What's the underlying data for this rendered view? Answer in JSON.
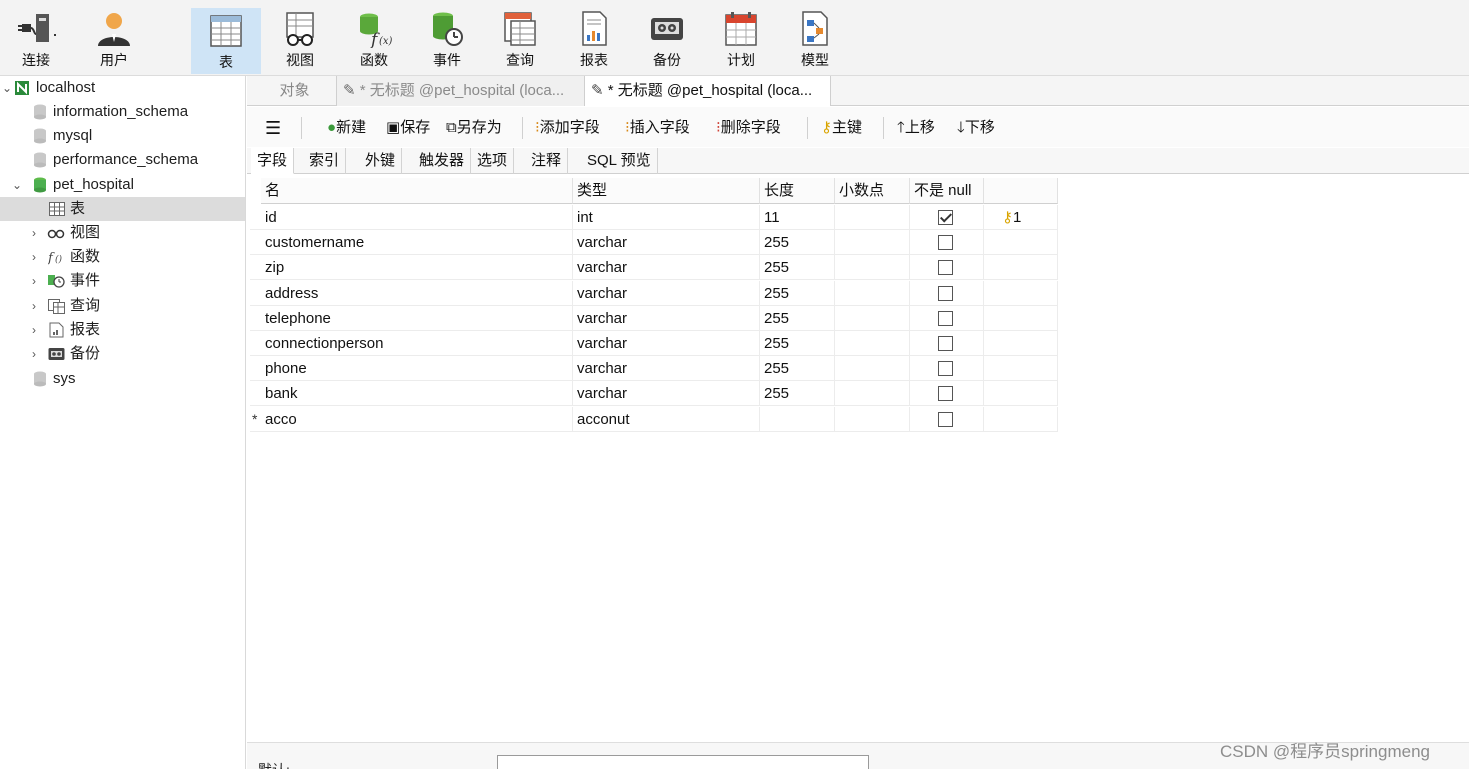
{
  "toolbar": {
    "items": [
      {
        "label": "连接",
        "icon": "plug-icon"
      },
      {
        "label": "用户",
        "icon": "user-icon"
      },
      {
        "label": "表",
        "icon": "table-icon",
        "active": true
      },
      {
        "label": "视图",
        "icon": "view-icon"
      },
      {
        "label": "函数",
        "icon": "function-icon"
      },
      {
        "label": "事件",
        "icon": "event-icon"
      },
      {
        "label": "查询",
        "icon": "query-icon"
      },
      {
        "label": "报表",
        "icon": "report-icon"
      },
      {
        "label": "备份",
        "icon": "backup-icon"
      },
      {
        "label": "计划",
        "icon": "schedule-icon"
      },
      {
        "label": "模型",
        "icon": "model-icon"
      }
    ]
  },
  "sidebar": {
    "connection": "localhost",
    "databases": [
      "information_schema",
      "mysql",
      "performance_schema",
      "pet_hospital",
      "sys"
    ],
    "children": [
      {
        "label": "表",
        "icon": "table-icon"
      },
      {
        "label": "视图",
        "icon": "view-icon"
      },
      {
        "label": "函数",
        "icon": "function-icon"
      },
      {
        "label": "事件",
        "icon": "event-icon"
      },
      {
        "label": "查询",
        "icon": "query-icon"
      },
      {
        "label": "报表",
        "icon": "report-icon"
      },
      {
        "label": "备份",
        "icon": "backup-icon"
      }
    ]
  },
  "tabs": {
    "objects": "对象",
    "tab1": "* 无标题 @pet_hospital (loca...",
    "tab2": "* 无标题 @pet_hospital (loca..."
  },
  "edit_toolbar": {
    "new": "新建",
    "save": "保存",
    "save_as": "另存为",
    "add_field": "添加字段",
    "insert_field": "插入字段",
    "delete_field": "删除字段",
    "primary_key": "主键",
    "move_up": "上移",
    "move_down": "下移"
  },
  "subtabs": [
    "字段",
    "索引",
    "外键",
    "触发器",
    "选项",
    "注释",
    "SQL 预览"
  ],
  "grid": {
    "headers": [
      "名",
      "类型",
      "长度",
      "小数点",
      "不是 null"
    ],
    "rows": [
      {
        "name": "id",
        "type": "int",
        "length": "11",
        "decimals": "",
        "not_null": true,
        "key": "1"
      },
      {
        "name": "customername",
        "type": "varchar",
        "length": "255",
        "decimals": "",
        "not_null": false,
        "key": ""
      },
      {
        "name": "zip",
        "type": "varchar",
        "length": "255",
        "decimals": "",
        "not_null": false,
        "key": ""
      },
      {
        "name": "address",
        "type": "varchar",
        "length": "255",
        "decimals": "",
        "not_null": false,
        "key": ""
      },
      {
        "name": "telephone",
        "type": "varchar",
        "length": "255",
        "decimals": "",
        "not_null": false,
        "key": ""
      },
      {
        "name": "connectionperson",
        "type": "varchar",
        "length": "255",
        "decimals": "",
        "not_null": false,
        "key": ""
      },
      {
        "name": "phone",
        "type": "varchar",
        "length": "255",
        "decimals": "",
        "not_null": false,
        "key": ""
      },
      {
        "name": "bank",
        "type": "varchar",
        "length": "255",
        "decimals": "",
        "not_null": false,
        "key": ""
      },
      {
        "name": "acco",
        "type": "acconut",
        "length": "",
        "decimals": "",
        "not_null": false,
        "key": "",
        "editing": true
      }
    ]
  },
  "bottom": {
    "label": "默认:"
  },
  "watermark": "CSDN @程序员springmeng",
  "colors": {
    "active_toolbar": "#cfe4f6",
    "selected_row": "#dcdcdc",
    "key_icon": "#d9a400",
    "db_icon": "#4caf50"
  }
}
